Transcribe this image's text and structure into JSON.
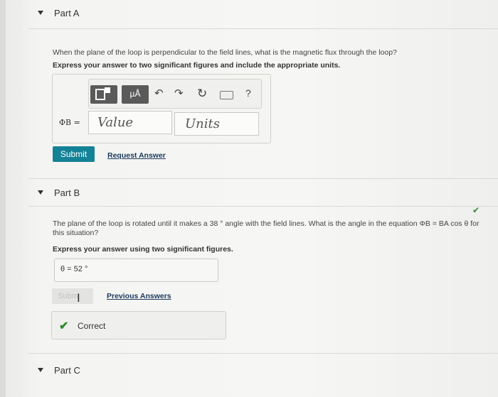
{
  "part_a": {
    "title": "Part A",
    "question": "When the plane of the loop is perpendicular to the field lines, what is the magnetic flux through the loop?",
    "instruction": "Express your answer to two significant figures and include the appropriate units.",
    "toolbar": {
      "template_icon": "templates-icon",
      "units_btn": "µÅ",
      "undo_icon": "↶",
      "redo_icon": "↷",
      "reset_icon": "↻",
      "help": "?"
    },
    "variable_label": "ΦB =",
    "value_placeholder": "Value",
    "units_placeholder": "Units",
    "submit_label": "Submit",
    "request_answer_label": "Request Answer"
  },
  "part_b": {
    "title": "Part B",
    "question_line1": "The plane of the loop is rotated until it makes a 38 ° angle with the field lines. What is the angle in the equation ΦB = BA cos θ for",
    "question_line2": "this situation?",
    "instruction": "Express your answer using two significant figures.",
    "answer_text": "θ =  52  °",
    "submit_label": "Subm",
    "previous_answers_label": "Previous Answers",
    "correct_label": "Correct",
    "check_mark": "✔"
  },
  "part_c": {
    "title": "Part C"
  }
}
